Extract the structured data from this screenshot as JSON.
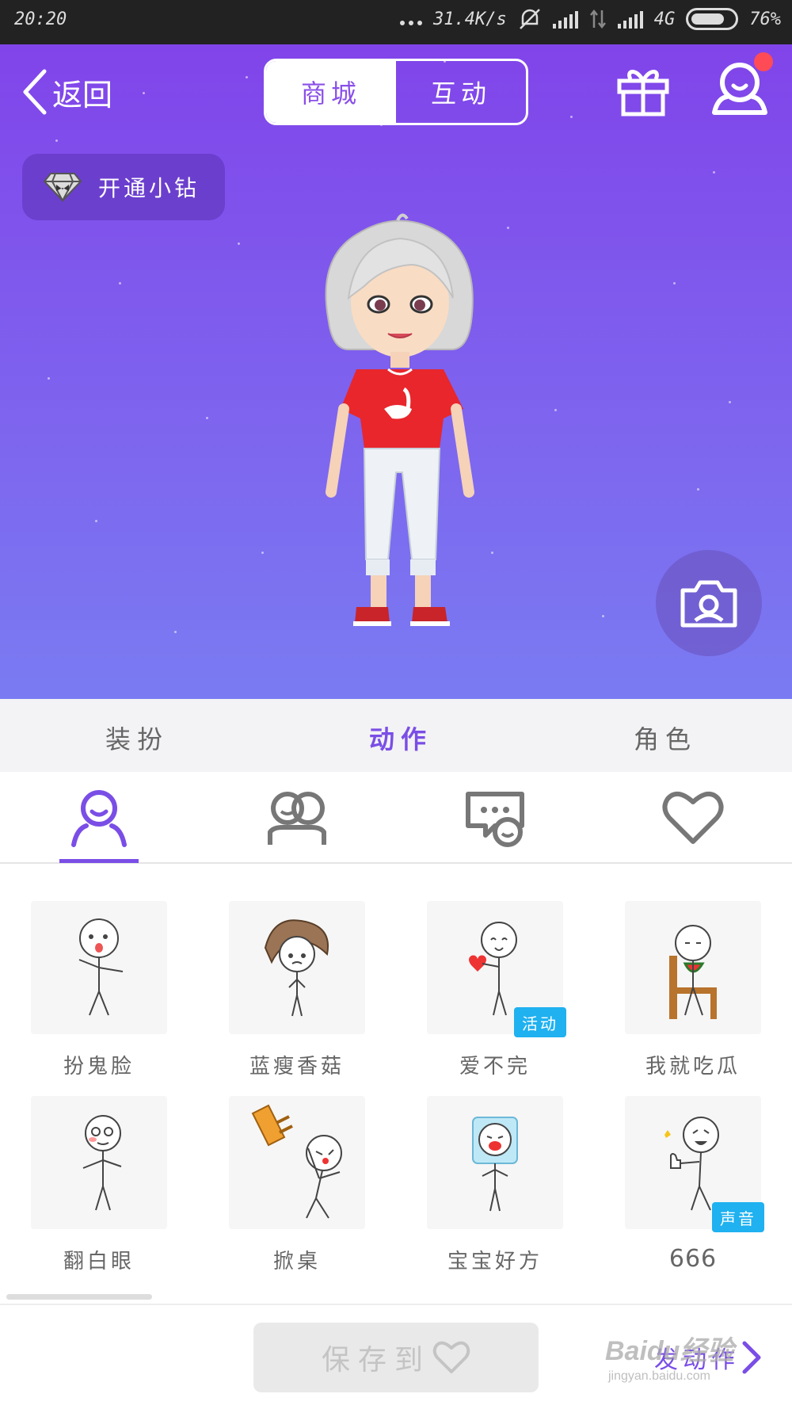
{
  "status_bar": {
    "time": "20:20",
    "speed": "31.4K/s",
    "network": "4G",
    "battery": "76%",
    "battery_level": 0.76
  },
  "header": {
    "back_label": "返回",
    "tabs": [
      {
        "label": "商城",
        "active": true
      },
      {
        "label": "互动",
        "active": false
      }
    ],
    "gift_icon": "gift-icon",
    "profile_icon": "user-icon"
  },
  "vip_button": {
    "label": "开通小钻",
    "icon": "diamond-icon"
  },
  "main_tabs": [
    {
      "label": "装扮",
      "active": false
    },
    {
      "label": "动作",
      "active": true
    },
    {
      "label": "角色",
      "active": false
    }
  ],
  "categories": [
    {
      "icon": "single-person-icon",
      "active": true
    },
    {
      "icon": "two-persons-icon",
      "active": false
    },
    {
      "icon": "chat-face-icon",
      "active": false
    },
    {
      "icon": "heart-icon",
      "active": false
    }
  ],
  "actions": [
    {
      "label": "扮鬼脸",
      "badge": ""
    },
    {
      "label": "蓝瘦香菇",
      "badge": ""
    },
    {
      "label": "爱不完",
      "badge": "活动"
    },
    {
      "label": "我就吃瓜",
      "badge": ""
    },
    {
      "label": "翻白眼",
      "badge": ""
    },
    {
      "label": "掀桌",
      "badge": ""
    },
    {
      "label": "宝宝好方",
      "badge": ""
    },
    {
      "label": "666",
      "badge": "声音"
    }
  ],
  "bottom": {
    "save_label": "保存到",
    "publish_label": "发动作",
    "watermark_main": "Baidu经验",
    "watermark_url": "jingyan.baidu.com"
  },
  "colors": {
    "accent": "#7a4ee6",
    "hero_top": "#8144ea",
    "hero_bottom": "#7a7bf2",
    "badge": "#1fb1f0",
    "notification": "#ff4b55"
  }
}
